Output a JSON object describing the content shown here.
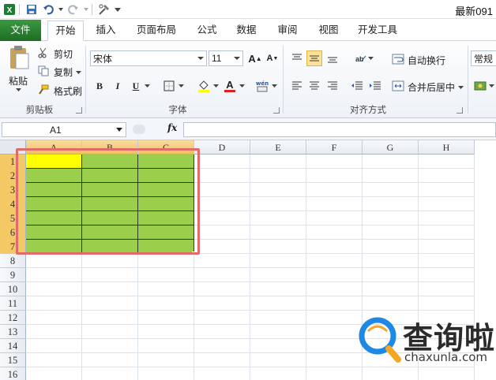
{
  "titlebar": {
    "title": "最新091"
  },
  "tabs": [
    {
      "label": "文件"
    },
    {
      "label": "开始"
    },
    {
      "label": "插入"
    },
    {
      "label": "页面布局"
    },
    {
      "label": "公式"
    },
    {
      "label": "数据"
    },
    {
      "label": "审阅"
    },
    {
      "label": "视图"
    },
    {
      "label": "开发工具"
    }
  ],
  "ribbon": {
    "clipboard": {
      "paste": "粘贴",
      "cut": "剪切",
      "copy": "复制",
      "format_painter": "格式刷",
      "label": "剪贴板"
    },
    "font": {
      "name": "宋体",
      "size": "11",
      "bold": "B",
      "italic": "I",
      "underline": "U",
      "label": "字体"
    },
    "alignment": {
      "wrap_text": "自动换行",
      "merge_center": "合并后居中",
      "label": "对齐方式"
    },
    "number": {
      "format": "常规"
    }
  },
  "formula_bar": {
    "name_box": "A1",
    "fx": "fx",
    "value": ""
  },
  "columns": [
    "A",
    "B",
    "C",
    "D",
    "E",
    "F",
    "G",
    "H"
  ],
  "rows": [
    "1",
    "2",
    "3",
    "4",
    "5",
    "6",
    "7",
    "8",
    "9",
    "10",
    "11",
    "12",
    "13",
    "14",
    "15",
    "16"
  ],
  "colors": {
    "fill_green": "#9bcf4b",
    "fill_yellow": "#ffff00",
    "highlight_border": "#e26a6a",
    "file_tab": "#2d7d32"
  },
  "watermark": {
    "text": "查询啦",
    "url": "chaxunla.com"
  }
}
